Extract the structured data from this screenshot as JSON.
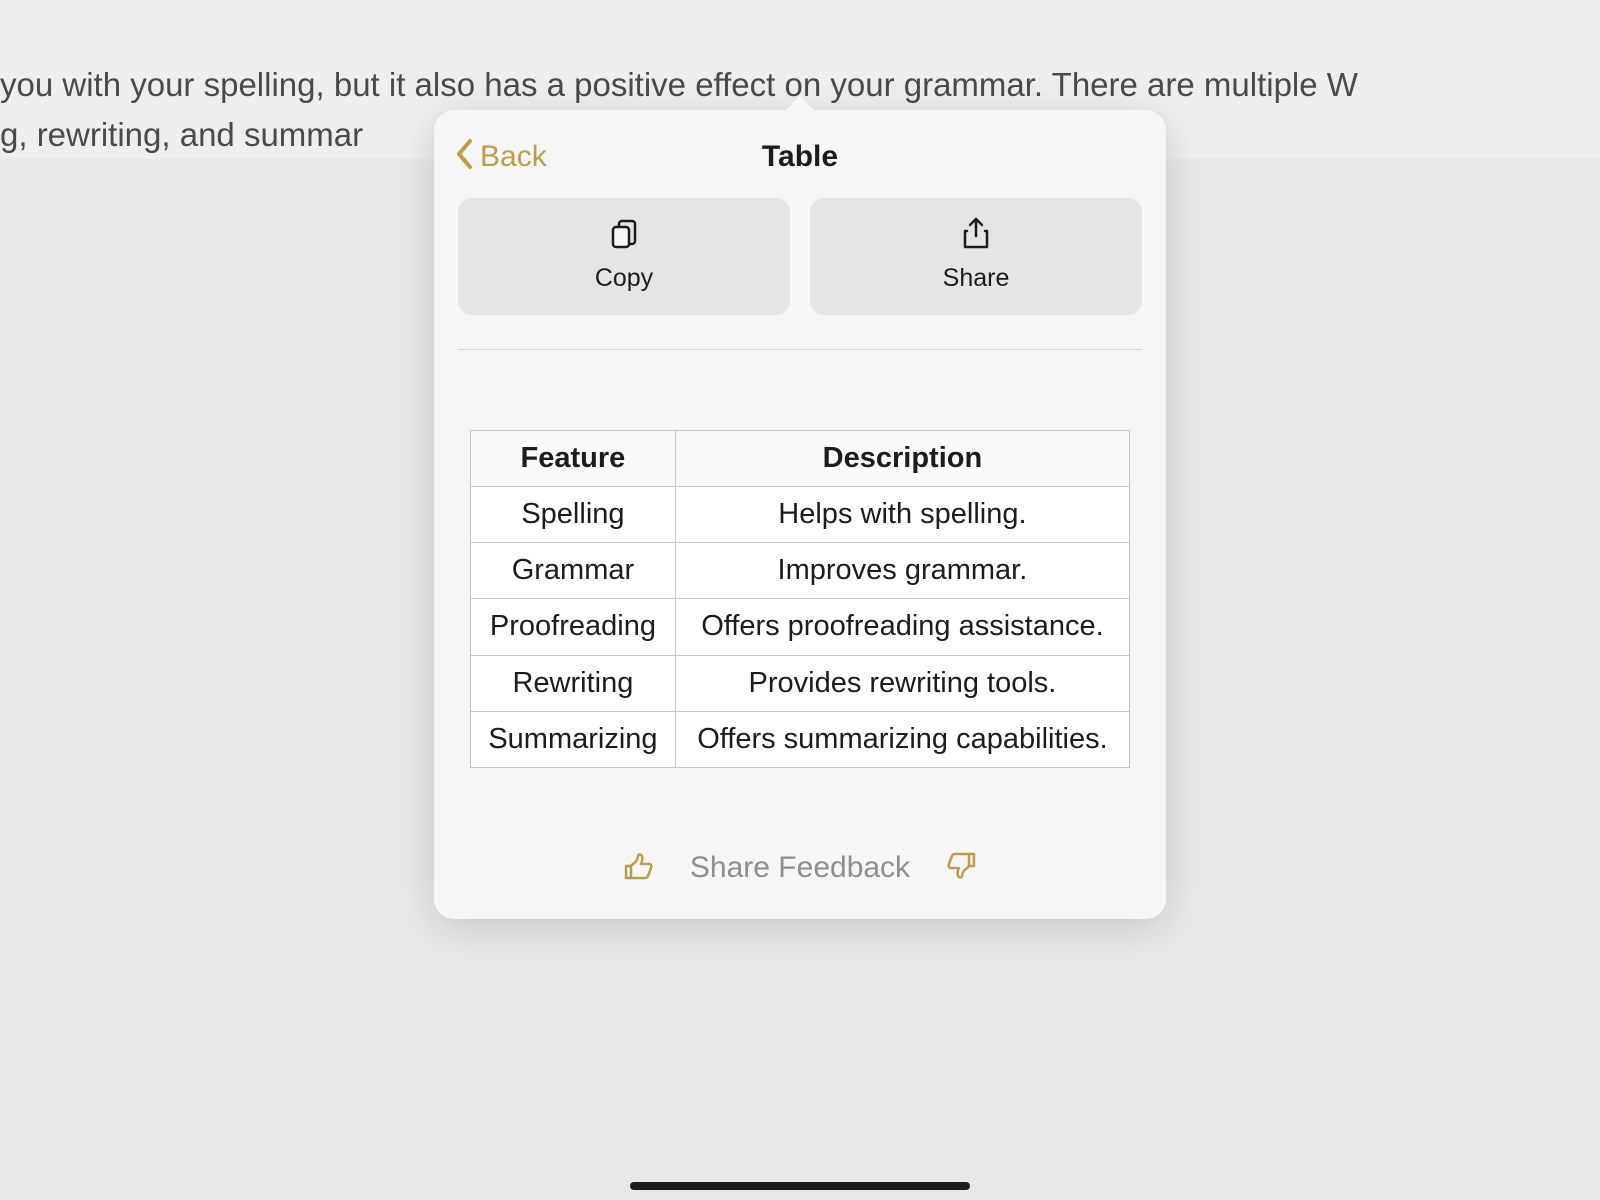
{
  "background": {
    "line1": "you with your spelling, but it also has a positive effect on your grammar. There are multiple W",
    "line2": "g, rewriting, and summar"
  },
  "popover": {
    "back_label": "Back",
    "title": "Table",
    "actions": {
      "copy_label": "Copy",
      "share_label": "Share"
    },
    "table": {
      "headers": {
        "feature": "Feature",
        "description": "Description"
      },
      "rows": [
        {
          "feature": "Spelling",
          "description": "Helps with spelling."
        },
        {
          "feature": "Grammar",
          "description": "Improves grammar."
        },
        {
          "feature": "Proofreading",
          "description": "Offers proofreading assistance."
        },
        {
          "feature": "Rewriting",
          "description": "Provides rewriting tools."
        },
        {
          "feature": "Summarizing",
          "description": "Offers summarizing capabilities."
        }
      ]
    },
    "feedback_label": "Share Feedback"
  },
  "chart_data": {
    "type": "table",
    "title": "Table",
    "columns": [
      "Feature",
      "Description"
    ],
    "rows": [
      [
        "Spelling",
        "Helps with spelling."
      ],
      [
        "Grammar",
        "Improves grammar."
      ],
      [
        "Proofreading",
        "Offers proofreading assistance."
      ],
      [
        "Rewriting",
        "Provides rewriting tools."
      ],
      [
        "Summarizing",
        "Offers summarizing capabilities."
      ]
    ]
  }
}
